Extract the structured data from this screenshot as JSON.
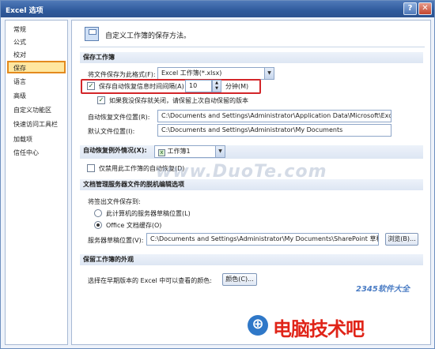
{
  "window": {
    "title": "Excel 选项",
    "help_glyph": "?",
    "close_glyph": "✕"
  },
  "nav": {
    "items": [
      {
        "label": "常规"
      },
      {
        "label": "公式"
      },
      {
        "label": "校对"
      },
      {
        "label": "保存",
        "active": true
      },
      {
        "label": "语言"
      },
      {
        "label": "高级"
      },
      {
        "label": "自定义功能区"
      },
      {
        "label": "快速访问工具栏"
      },
      {
        "label": "加载项"
      },
      {
        "label": "信任中心"
      }
    ]
  },
  "header": {
    "icon": "floppy-disk-icon",
    "text": "自定义工作簿的保存方法。"
  },
  "save_section": {
    "title": "保存工作簿",
    "format_label": "将文件保存为此格式(F):",
    "format_value": "Excel 工作簿(*.xlsx)",
    "autorecover_label": "保存自动恢复信息时间间隔(A)",
    "autorecover_checked": true,
    "autorecover_minutes": "10",
    "minutes_unit": "分钟(M)",
    "keep_last_label": "如果我没保存就关闭，请保留上次自动保留的版本",
    "keep_last_checked": true,
    "autorecover_location_label": "自动恢复文件位置(R):",
    "autorecover_location_value": "C:\\Documents and Settings\\Administrator\\Application Data\\Microsoft\\Excel\\",
    "default_location_label": "默认文件位置(I):",
    "default_location_value": "C:\\Documents and Settings\\Administrator\\My Documents"
  },
  "exceptions_section": {
    "title": "自动恢复例外情况(X):",
    "workbook_value": "工作簿1",
    "disable_label": "仅禁用此工作簿的自动恢复(D)",
    "disable_checked": false
  },
  "offline_section": {
    "title": "文档管理服务器文件的脱机编辑选项",
    "save_to_label": "将签出文件保存到:",
    "option_server": "此计算机的服务器草稿位置(L)",
    "option_cache": "Office 文档缓存(O)",
    "selected": "cache",
    "drafts_label": "服务器草稿位置(V):",
    "drafts_value": "C:\\Documents and Settings\\Administrator\\My Documents\\SharePoint 草稿\\",
    "browse_label": "浏览(B)..."
  },
  "appearance_section": {
    "title": "保留工作簿的外观",
    "colors_label": "选择在早期版本的 Excel 中可以查看的颜色:",
    "colors_button": "颜色(C)..."
  },
  "watermarks": {
    "center": "www.DuoTe.com",
    "small": "2345软件大全",
    "logo_text": "电脑技术吧"
  },
  "colors": {
    "accent": "#2f5a9c",
    "highlight": "#e38a1e",
    "red_box": "#d3262a",
    "logo_red": "#e02418"
  }
}
